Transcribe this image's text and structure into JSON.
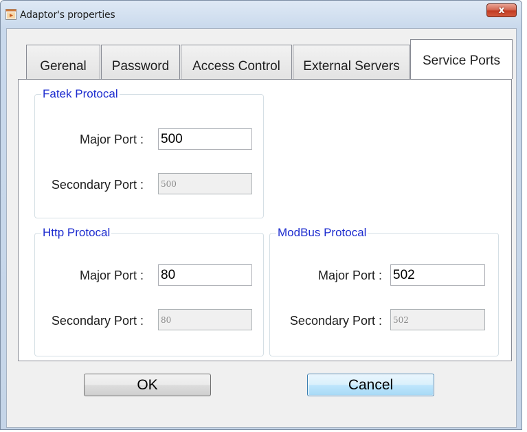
{
  "window": {
    "title": "Adaptor's properties",
    "close_glyph": "x"
  },
  "tabs": [
    {
      "label": "Gerenal"
    },
    {
      "label": "Password"
    },
    {
      "label": "Access Control"
    },
    {
      "label": "External Servers"
    },
    {
      "label": "Service Ports",
      "active": true
    }
  ],
  "groups": {
    "fatek": {
      "legend": "Fatek Protocal",
      "major_label": "Major Port :",
      "major_value": "500",
      "secondary_label": "Secondary Port :",
      "secondary_value": "500"
    },
    "http": {
      "legend": "Http Protocal",
      "major_label": "Major Port :",
      "major_value": "80",
      "secondary_label": "Secondary Port :",
      "secondary_value": "80"
    },
    "modbus": {
      "legend": "ModBus Protocal",
      "major_label": "Major Port :",
      "major_value": "502",
      "secondary_label": "Secondary Port :",
      "secondary_value": "502"
    }
  },
  "buttons": {
    "ok": "OK",
    "cancel": "Cancel"
  },
  "colors": {
    "legend_text": "#1d2ccf",
    "close_button": "#c23b22",
    "focused_button": "#bee6fd"
  },
  "icons": {
    "app": "window-app-icon",
    "close": "close-icon"
  }
}
